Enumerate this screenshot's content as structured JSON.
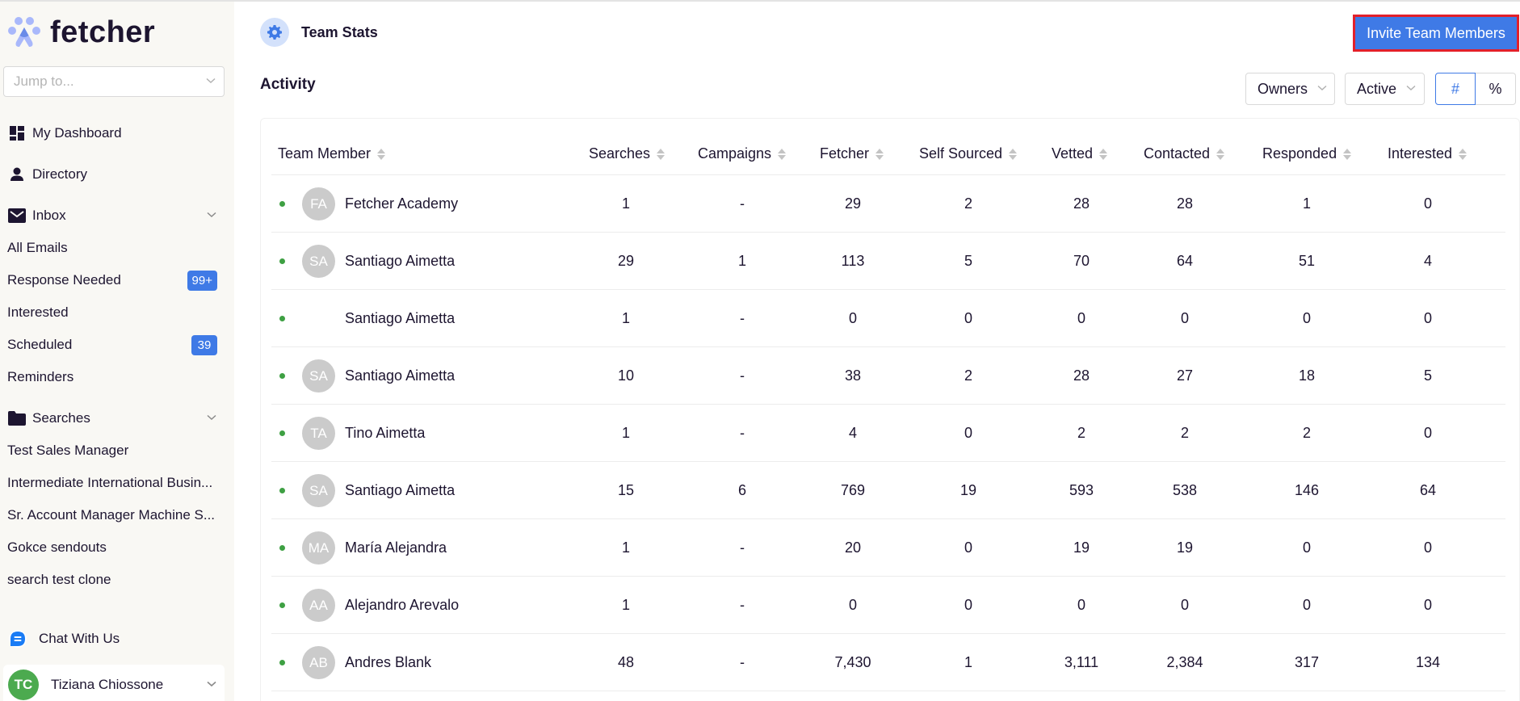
{
  "brand": {
    "name": "fetcher"
  },
  "sidebar": {
    "jump_placeholder": "Jump to...",
    "nav": [
      {
        "label": "My Dashboard",
        "icon": "dashboard-icon"
      },
      {
        "label": "Directory",
        "icon": "person-icon"
      },
      {
        "label": "Inbox",
        "icon": "mail-icon",
        "expandable": true
      }
    ],
    "inbox_items": [
      {
        "label": "All Emails"
      },
      {
        "label": "Response Needed",
        "badge": "99+"
      },
      {
        "label": "Interested"
      },
      {
        "label": "Scheduled",
        "badge": "39"
      },
      {
        "label": "Reminders"
      }
    ],
    "searches": {
      "label": "Searches",
      "icon": "folder-icon",
      "items": [
        {
          "label": "Test Sales Manager"
        },
        {
          "label": "Intermediate International Busin..."
        },
        {
          "label": "Sr. Account Manager Machine S..."
        },
        {
          "label": "Gokce sendouts"
        },
        {
          "label": "search test clone"
        }
      ]
    },
    "chat_label": "Chat With Us",
    "user": {
      "initials": "TC",
      "name": "Tiziana Chiossone"
    }
  },
  "header": {
    "title": "Team Stats",
    "invite_label": "Invite Team Members"
  },
  "activity": {
    "title": "Activity",
    "filters": {
      "owners": "Owners",
      "status": "Active",
      "mode_options": [
        "#",
        "%"
      ],
      "mode_selected": "#"
    }
  },
  "table": {
    "columns": [
      "Team Member",
      "Searches",
      "Campaigns",
      "Fetcher",
      "Self Sourced",
      "Vetted",
      "Contacted",
      "Responded",
      "Interested"
    ],
    "rows": [
      {
        "initials": "FA",
        "name": "Fetcher Academy",
        "values": [
          "1",
          "-",
          "29",
          "2",
          "28",
          "28",
          "1",
          "0"
        ]
      },
      {
        "initials": "SA",
        "name": "Santiago Aimetta",
        "values": [
          "29",
          "1",
          "113",
          "5",
          "70",
          "64",
          "51",
          "4"
        ]
      },
      {
        "initials": "",
        "name": "Santiago Aimetta",
        "values": [
          "1",
          "-",
          "0",
          "0",
          "0",
          "0",
          "0",
          "0"
        ]
      },
      {
        "initials": "SA",
        "name": "Santiago Aimetta",
        "values": [
          "10",
          "-",
          "38",
          "2",
          "28",
          "27",
          "18",
          "5"
        ]
      },
      {
        "initials": "TA",
        "name": "Tino Aimetta",
        "values": [
          "1",
          "-",
          "4",
          "0",
          "2",
          "2",
          "2",
          "0"
        ]
      },
      {
        "initials": "SA",
        "name": "Santiago Aimetta",
        "values": [
          "15",
          "6",
          "769",
          "19",
          "593",
          "538",
          "146",
          "64"
        ]
      },
      {
        "initials": "MA",
        "name": "María Alejandra",
        "values": [
          "1",
          "-",
          "20",
          "0",
          "19",
          "19",
          "0",
          "0"
        ]
      },
      {
        "initials": "AA",
        "name": "Alejandro Arevalo",
        "values": [
          "1",
          "-",
          "0",
          "0",
          "0",
          "0",
          "0",
          "0"
        ]
      },
      {
        "initials": "AB",
        "name": "Andres Blank",
        "values": [
          "48",
          "-",
          "7,430",
          "1",
          "3,111",
          "2,384",
          "317",
          "134"
        ]
      }
    ]
  },
  "colors": {
    "accent": "#3f7ae6",
    "sidebar_bg": "#f9f8f4",
    "status_active": "#3ea043",
    "user_avatar": "#4caa4f",
    "highlight_border": "#e3202a"
  }
}
